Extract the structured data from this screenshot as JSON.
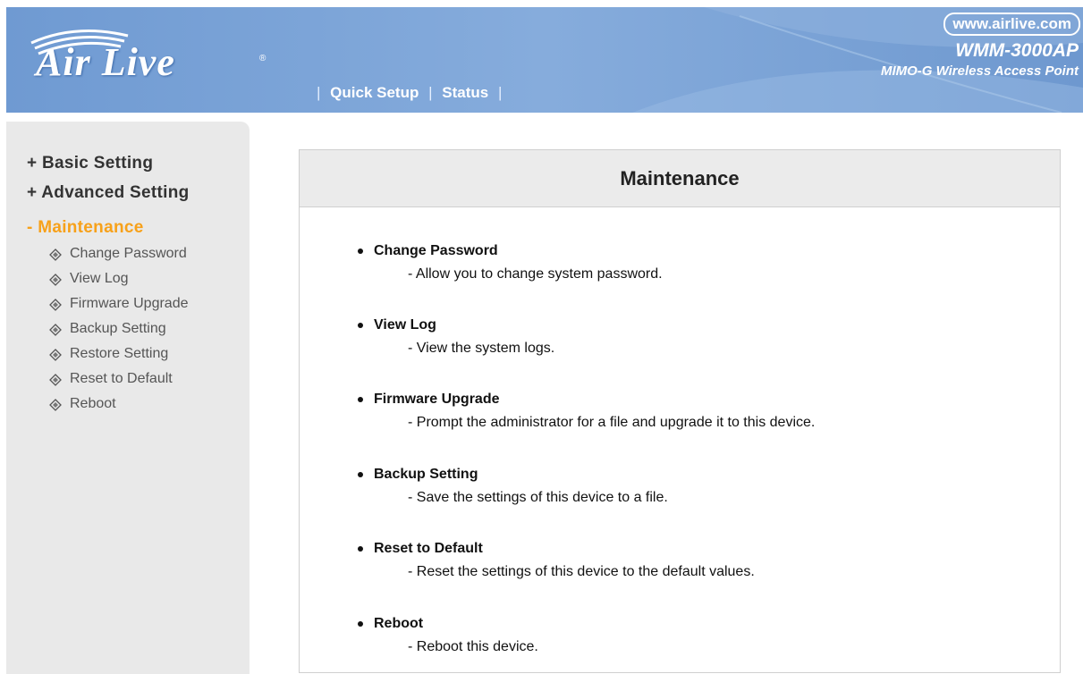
{
  "header": {
    "logo_text": "Air Live",
    "logo_reg": "®",
    "nav": [
      {
        "label": "Quick Setup"
      },
      {
        "label": "Status"
      }
    ],
    "nav_sep": "|",
    "website": "www.airlive.com",
    "model": "WMM-3000AP",
    "subtitle": "MIMO-G Wireless Access Point"
  },
  "sidebar": {
    "sections": [
      {
        "label": "+ Basic Setting"
      },
      {
        "label": "+ Advanced Setting"
      },
      {
        "label": "- Maintenance"
      }
    ],
    "items": [
      {
        "label": "Change Password"
      },
      {
        "label": "View Log"
      },
      {
        "label": "Firmware Upgrade"
      },
      {
        "label": "Backup Setting"
      },
      {
        "label": "Restore Setting"
      },
      {
        "label": "Reset to Default"
      },
      {
        "label": "Reboot"
      }
    ]
  },
  "main": {
    "title": "Maintenance",
    "items": [
      {
        "title": "Change Password",
        "desc": "- Allow you to change system password."
      },
      {
        "title": "View Log",
        "desc": "- View the system logs."
      },
      {
        "title": "Firmware Upgrade",
        "desc": "- Prompt the administrator for a file and upgrade it to this device."
      },
      {
        "title": "Backup Setting",
        "desc": "- Save the settings of this device to a file."
      },
      {
        "title": "Reset to Default",
        "desc": "- Reset the settings of this device to the default values."
      },
      {
        "title": "Reboot",
        "desc": "- Reboot this device."
      }
    ]
  },
  "colors": {
    "header_bg": "#7aa3d6",
    "sidebar_bg": "#e9e9e9",
    "active_accent": "#f7a11a"
  }
}
